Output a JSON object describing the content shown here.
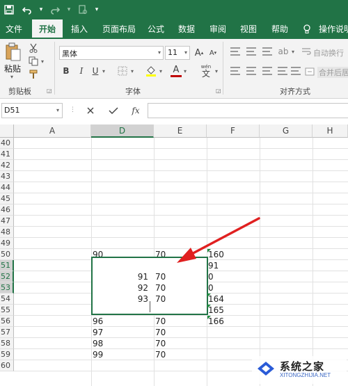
{
  "quick_access": {
    "save_icon": "save-icon",
    "undo_icon": "undo-icon",
    "redo_icon": "redo-icon",
    "touch_mode_icon": "touch-mode-icon",
    "customize_icon": "customize-icon"
  },
  "tabs": [
    {
      "label": "文件"
    },
    {
      "label": "开始",
      "active": true
    },
    {
      "label": "插入"
    },
    {
      "label": "页面布局"
    },
    {
      "label": "公式"
    },
    {
      "label": "数据"
    },
    {
      "label": "审阅"
    },
    {
      "label": "视图"
    },
    {
      "label": "帮助"
    },
    {
      "label": "操作说明"
    }
  ],
  "ribbon": {
    "clipboard": {
      "paste_label": "粘贴",
      "group_label": "剪贴板"
    },
    "font": {
      "font_name": "黑体",
      "font_size": "11",
      "grow_label": "A",
      "shrink_label": "A",
      "bold": "B",
      "italic": "I",
      "underline": "U",
      "font_color_letter": "A",
      "phonetic_label": "wén",
      "group_label": "字体",
      "font_color": "#c00000"
    },
    "alignment": {
      "wrap_text_label": "自动换行",
      "merge_label": "合并后居中",
      "group_label": "对齐方式"
    }
  },
  "formula_bar": {
    "name_box": "D51",
    "cancel_icon": "close-icon",
    "enter_icon": "check-icon",
    "fx_label": "fx",
    "formula": ""
  },
  "grid": {
    "columns": [
      "A",
      "D",
      "E",
      "F",
      "G",
      "H"
    ],
    "selected_column": "D",
    "rows": [
      "40",
      "41",
      "42",
      "43",
      "44",
      "45",
      "46",
      "47",
      "48",
      "49",
      "50",
      "51",
      "52",
      "53",
      "54",
      "55",
      "56",
      "57",
      "58",
      "59",
      "60"
    ],
    "selected_rows": [
      "51",
      "52",
      "53"
    ],
    "cells": [
      {
        "ref": "D50",
        "value": "90"
      },
      {
        "ref": "E50",
        "value": "70"
      },
      {
        "ref": "F50",
        "value": "160"
      },
      {
        "ref": "F51",
        "value": "91"
      },
      {
        "ref": "F52",
        "value": "0"
      },
      {
        "ref": "F53",
        "value": "0"
      },
      {
        "ref": "D52",
        "value": "91"
      },
      {
        "ref": "E52",
        "value": "70"
      },
      {
        "ref": "D53",
        "value": "92"
      },
      {
        "ref": "E53",
        "value": "70"
      },
      {
        "ref": "D54",
        "value": "93"
      },
      {
        "ref": "E54",
        "value": "70"
      },
      {
        "ref": "F54",
        "value": "164"
      },
      {
        "ref": "F55",
        "value": "165"
      },
      {
        "ref": "D56",
        "value": "96"
      },
      {
        "ref": "E56",
        "value": "70"
      },
      {
        "ref": "F56",
        "value": "166"
      },
      {
        "ref": "D57",
        "value": "97"
      },
      {
        "ref": "E57",
        "value": "70"
      },
      {
        "ref": "D58",
        "value": "98"
      },
      {
        "ref": "E58",
        "value": "70"
      },
      {
        "ref": "D59",
        "value": "99"
      },
      {
        "ref": "E59",
        "value": "70"
      }
    ]
  },
  "annotation": {
    "arrow_color": "#e02020"
  },
  "watermark": {
    "title": "系统之家",
    "subtitle": "XITONGZHIJIA.NET"
  },
  "colors": {
    "accent": "#217346"
  }
}
